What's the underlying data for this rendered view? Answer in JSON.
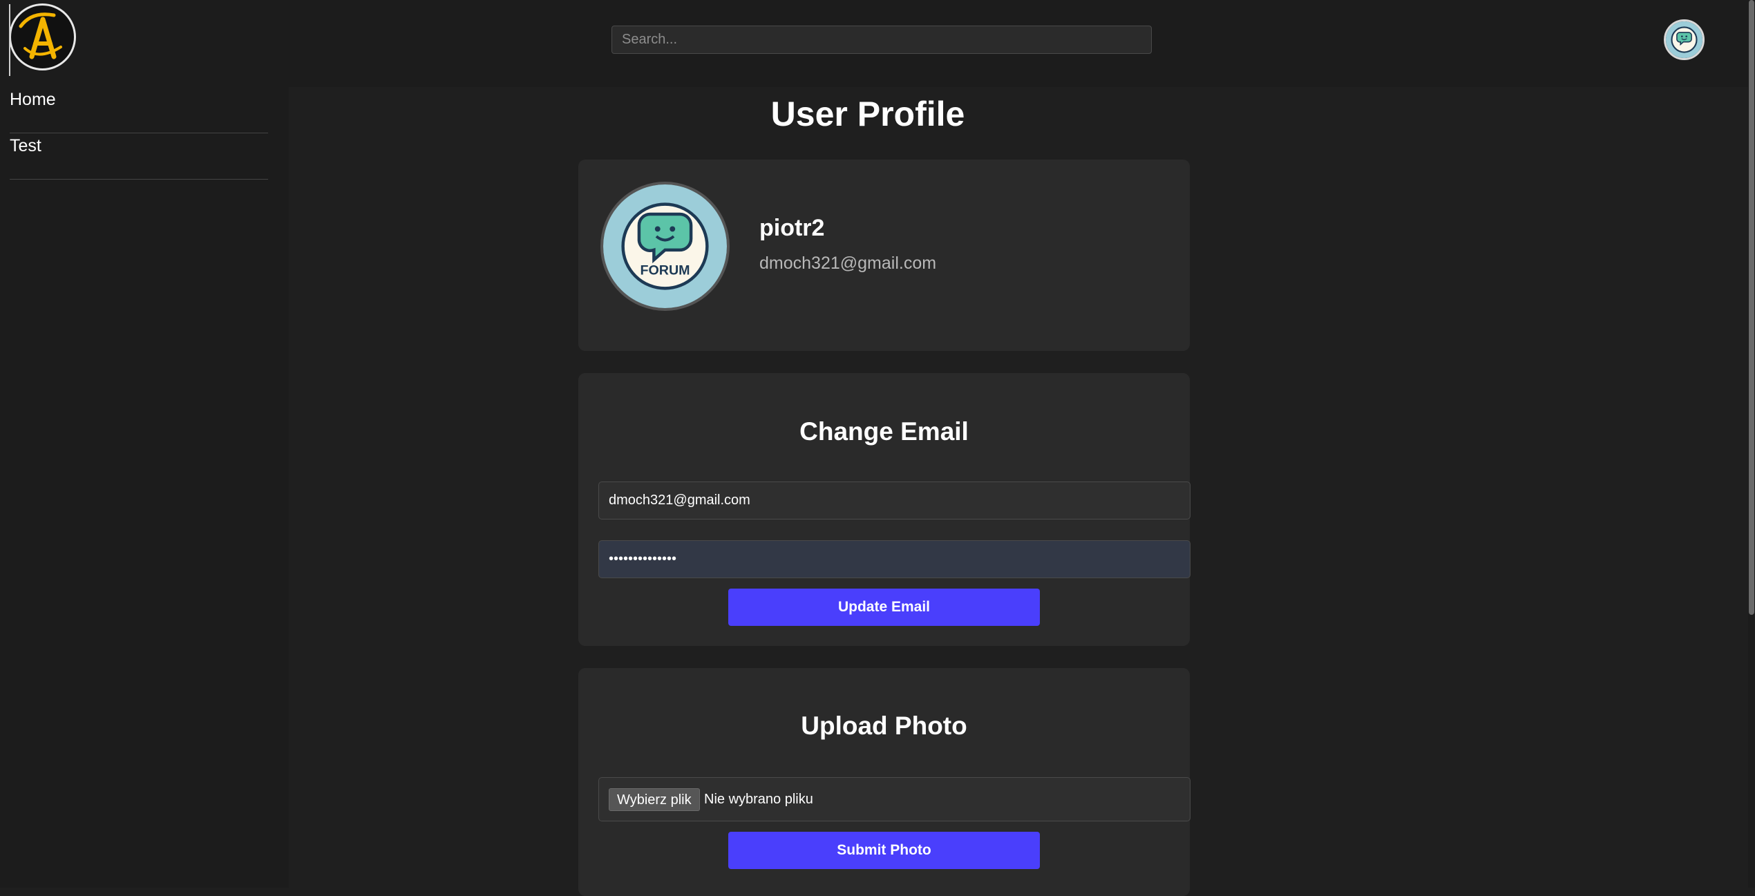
{
  "header": {
    "search_placeholder": "Search..."
  },
  "sidebar": {
    "items": [
      {
        "label": "Home"
      },
      {
        "label": "Test"
      }
    ]
  },
  "page": {
    "title": "User Profile"
  },
  "profile": {
    "username": "piotr2",
    "email": "dmoch321@gmail.com",
    "avatar_text": "FORUM"
  },
  "change_email": {
    "title": "Change Email",
    "email_value": "dmoch321@gmail.com",
    "password_value": "••••••••••••••",
    "button_label": "Update Email"
  },
  "upload_photo": {
    "title": "Upload Photo",
    "choose_file_label": "Wybierz plik",
    "file_status": "Nie wybrano pliku",
    "button_label": "Submit Photo"
  },
  "colors": {
    "accent": "#4a3ffc",
    "background": "#1f1f1f",
    "card": "#2a2a2a"
  }
}
